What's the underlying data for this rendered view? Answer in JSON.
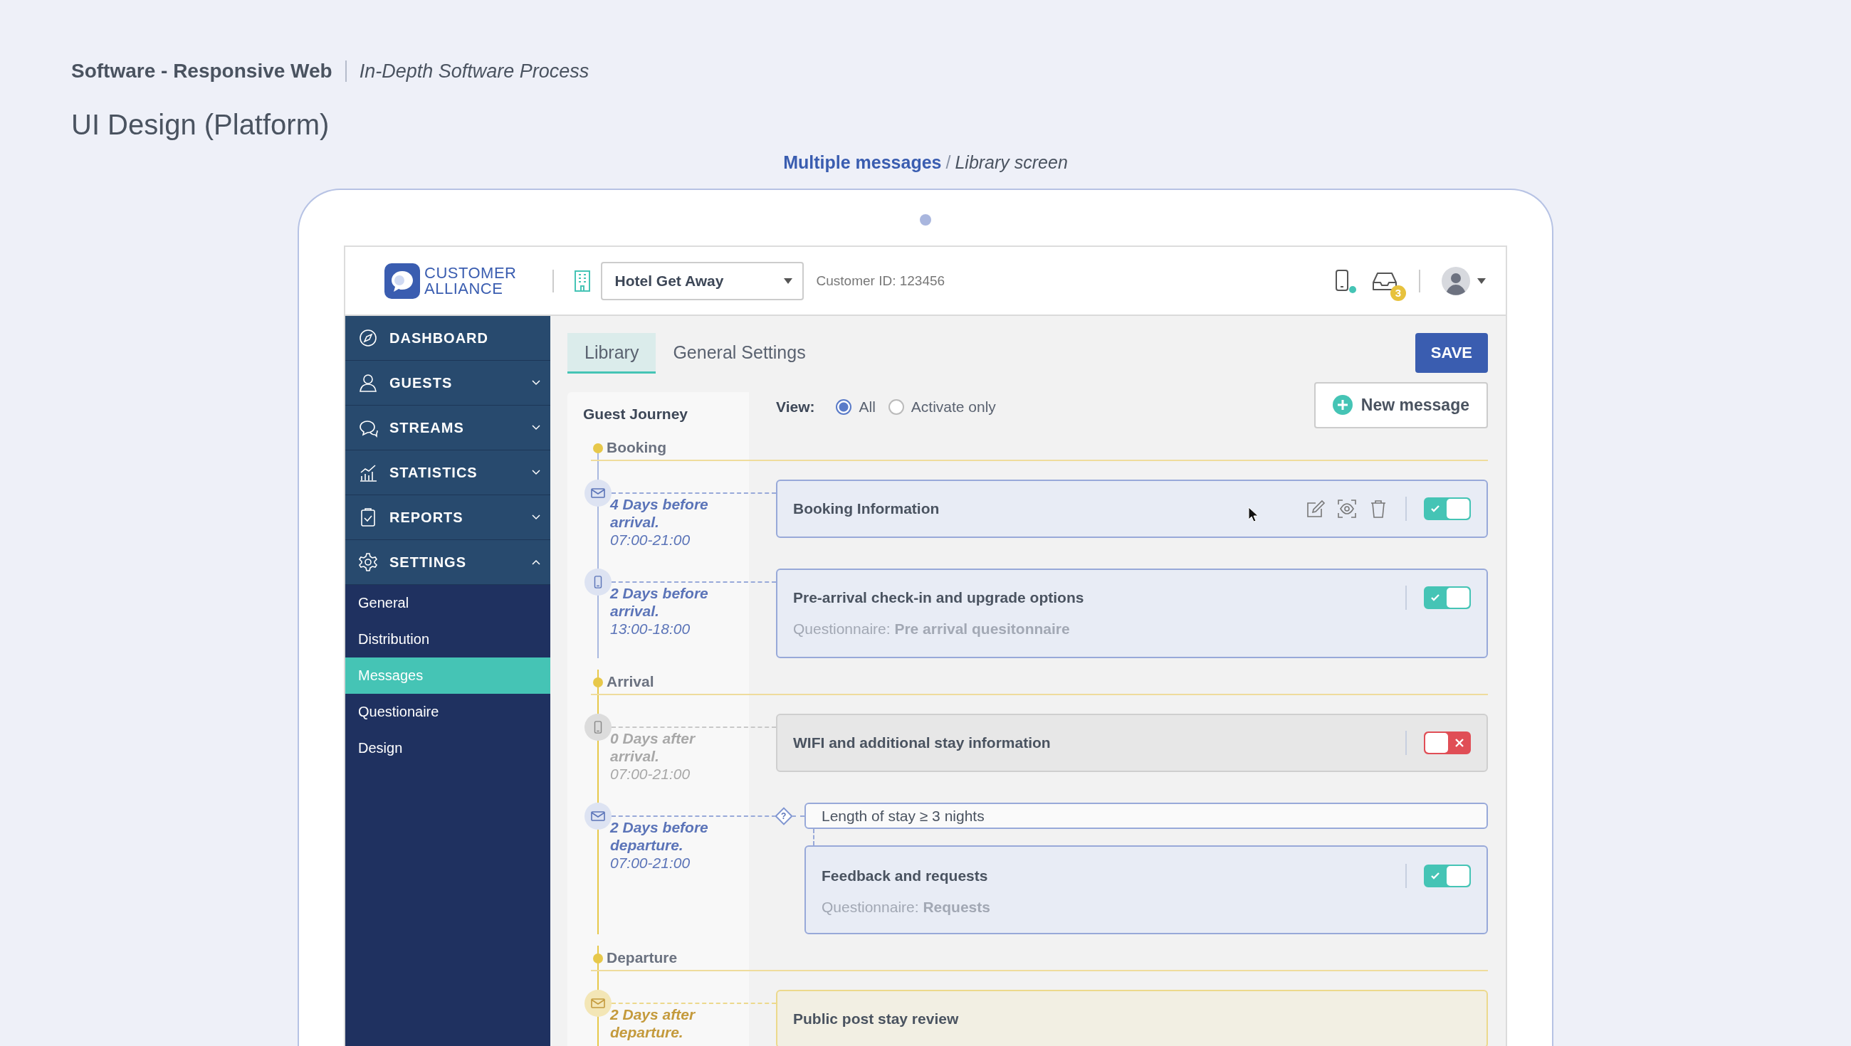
{
  "page_header": {
    "project": "Software - Responsive Web",
    "process": "In-Depth Software Process",
    "title": "UI Design (Platform)",
    "caption_link": "Multiple messages",
    "caption_separator": "/",
    "caption_screen": "Library screen"
  },
  "app_bar": {
    "logo_line1": "CUSTOMER",
    "logo_line2": "ALLIANCE",
    "hotel_select": "Hotel Get Away",
    "customer_id": "Customer ID: 123456",
    "phone_online": true,
    "inbox_count": "3"
  },
  "sidebar": [
    {
      "label": "DASHBOARD"
    },
    {
      "label": "GUESTS",
      "expanded": false
    },
    {
      "label": "STREAMS",
      "expanded": false
    },
    {
      "label": "STATISTICS",
      "expanded": false
    },
    {
      "label": "REPORTS",
      "expanded": false
    },
    {
      "label": "SETTINGS",
      "expanded": true,
      "children": [
        {
          "label": "General",
          "selected": false
        },
        {
          "label": "Distribution",
          "selected": false
        },
        {
          "label": "Messages",
          "selected": true
        },
        {
          "label": "Questionaire",
          "selected": false
        },
        {
          "label": "Design",
          "selected": false
        }
      ]
    }
  ],
  "tabs": [
    {
      "label": "Library",
      "selected": true
    },
    {
      "label": "General Settings",
      "selected": false
    }
  ],
  "save_button": "SAVE",
  "journey": {
    "heading": "Guest Journey",
    "view_label": "View:",
    "view_options": [
      {
        "label": "All",
        "selected": true
      },
      {
        "label": "Activate only",
        "selected": false
      }
    ],
    "new_message": "New message",
    "stages": [
      {
        "name": "Booking",
        "messages": [
          {
            "kind": "email",
            "timing": "4 Days before arrival.",
            "time": "07:00-21:00",
            "title": "Booking Information",
            "hovered": true,
            "on": true
          },
          {
            "kind": "phone",
            "timing": "2 Days before arrival.",
            "time": "13:00-18:00",
            "title": "Pre-arrival check-in and upgrade options",
            "questionnaire": "Questionnaire: **Pre arrival quesitonnaire**",
            "hovered": false,
            "on": true
          }
        ]
      },
      {
        "name": "Arrival",
        "messages": [
          {
            "kind": "phone",
            "timing": "0 Days after arrival.",
            "time": "07:00-21:00",
            "title": "WIFI and additional stay information",
            "hovered": false,
            "on": false
          },
          {
            "kind": "email",
            "timing": "2 Days before departure.",
            "time": "07:00-21:00",
            "condition": {
              "icon": "?",
              "text": "Length of stay ≥ 3 nights"
            },
            "title": "Feedback and requests",
            "questionnaire": "Questionnaire: **Requests**",
            "hovered": false,
            "on": true
          }
        ]
      },
      {
        "name": "Departure",
        "messages": [
          {
            "kind": "email",
            "timing": "2 Days after departure.",
            "public": true,
            "title": "Public post stay review",
            "hovered": false
          }
        ]
      }
    ]
  }
}
